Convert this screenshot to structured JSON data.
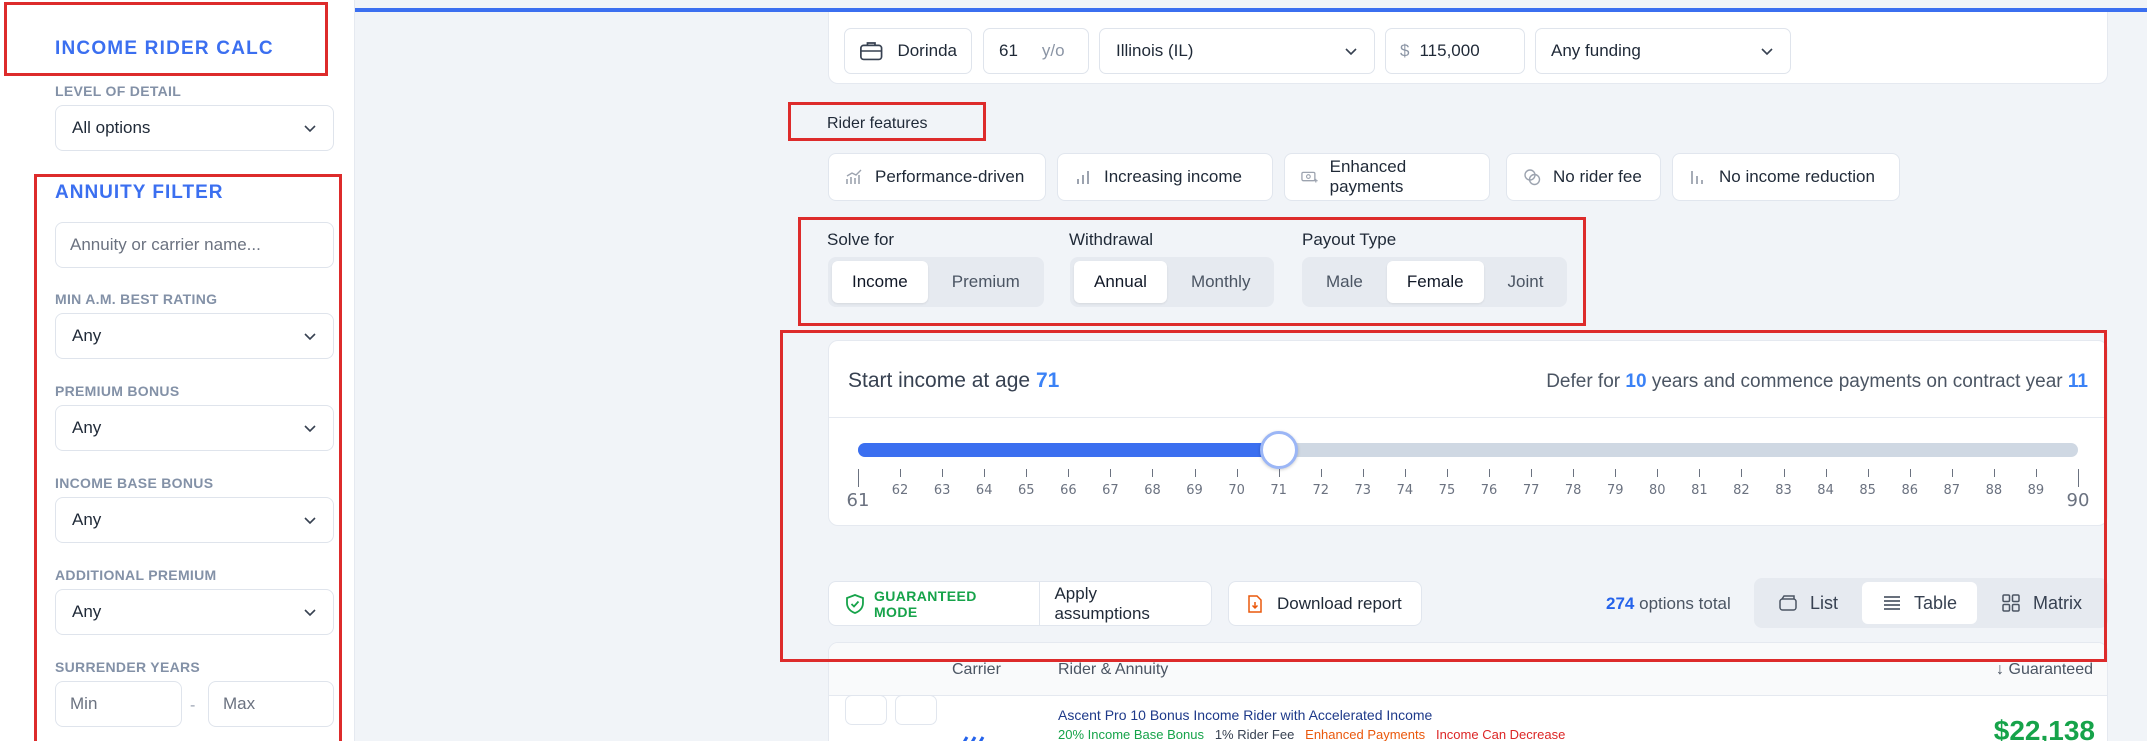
{
  "sidebar": {
    "app_title": "INCOME RIDER CALC",
    "level_of_detail": {
      "label": "LEVEL OF DETAIL",
      "value": "All options"
    },
    "annuity_filter": {
      "title": "ANNUITY FILTER",
      "search_placeholder": "Annuity or carrier name...",
      "min_rating": {
        "label": "MIN A.M. BEST RATING",
        "value": "Any"
      },
      "premium_bonus": {
        "label": "PREMIUM BONUS",
        "value": "Any"
      },
      "income_base_bonus": {
        "label": "INCOME BASE BONUS",
        "value": "Any"
      },
      "additional_premium": {
        "label": "ADDITIONAL PREMIUM",
        "value": "Any"
      },
      "surrender_years": {
        "label": "SURRENDER YEARS",
        "min_placeholder": "Min",
        "max_placeholder": "Max",
        "separator": "-"
      }
    }
  },
  "filter_bar": {
    "client_name": "Dorinda",
    "age": "61",
    "age_unit": "y/o",
    "state": "Illinois (IL)",
    "currency": "$",
    "amount": "115,000",
    "funding": "Any funding"
  },
  "rider_features": {
    "label": "Rider features",
    "items": [
      {
        "label": "Performance-driven",
        "icon": "trend-chart-icon"
      },
      {
        "label": "Increasing income",
        "icon": "bar-chart-icon"
      },
      {
        "label": "Enhanced payments",
        "icon": "money-plus-icon"
      },
      {
        "label": "No rider fee",
        "icon": "coins-icon"
      },
      {
        "label": "No income reduction",
        "icon": "bars-icon"
      }
    ]
  },
  "solve_for": {
    "label": "Solve for",
    "options": [
      "Income",
      "Premium"
    ],
    "selected": "Income"
  },
  "withdrawal": {
    "label": "Withdrawal",
    "options": [
      "Annual",
      "Monthly"
    ],
    "selected": "Annual"
  },
  "payout_type": {
    "label": "Payout Type",
    "options": [
      "Male",
      "Female",
      "Joint"
    ],
    "selected": "Female"
  },
  "income_start": {
    "title_prefix": "Start income at age",
    "age": "71",
    "defer_prefix": "Defer for",
    "defer_years": "10",
    "defer_middle": "years and commence payments on contract year",
    "contract_year": "11",
    "slider": {
      "min": 61,
      "max": 90,
      "value": 71
    }
  },
  "actions": {
    "guaranteed_mode": "GUARANTEED MODE",
    "apply_assumptions": "Apply assumptions",
    "download_report": "Download report",
    "options_count": "274",
    "options_suffix": "options total",
    "views": [
      {
        "label": "List",
        "icon": "wallet-icon"
      },
      {
        "label": "Table",
        "icon": "lines-icon"
      },
      {
        "label": "Matrix",
        "icon": "grid-icon"
      }
    ],
    "selected_view": "Table"
  },
  "results_table": {
    "columns": {
      "carrier": "Carrier",
      "rider": "Rider & Annuity",
      "guaranteed": "↓ Guaranteed"
    },
    "rows": [
      {
        "name": "Ascent Pro 10 Bonus Income Rider with Accelerated Income",
        "tags": [
          "20% Income Base Bonus",
          "1% Rider Fee",
          "Enhanced Payments",
          "Income Can Decrease"
        ],
        "amount": "$22,138"
      }
    ]
  },
  "colors": {
    "accent": "#3b6ff0",
    "positive": "#16a34a",
    "warning": "#ea580c",
    "danger": "#dc2626",
    "annotation": "#dd2b2b"
  }
}
